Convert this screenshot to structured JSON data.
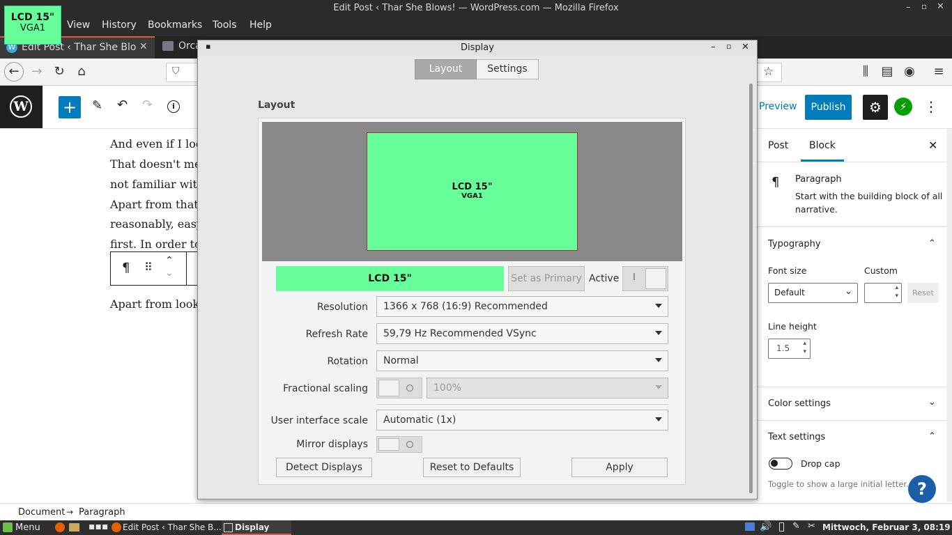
{
  "window": {
    "title": "Edit Post ‹ Thar She Blows! — WordPress.com — Mozilla Firefox"
  },
  "menubar": {
    "items": [
      "View",
      "History",
      "Bookmarks",
      "Tools",
      "Help"
    ]
  },
  "tabs": [
    {
      "label": "Edit Post ‹ Thar She Blow",
      "active": true
    },
    {
      "label": "Orca",
      "active": false
    }
  ],
  "osd": {
    "name": "LCD 15\"",
    "output": "VGA1",
    "color": "#66ff99"
  },
  "wp": {
    "preview_label": "Preview",
    "publish_label": "Publish",
    "content_lines": [
      "And even if I loo",
      "That doesn't mea",
      "not familiar with",
      "Apart from that",
      "reasonably, easy",
      "first. In order to"
    ],
    "paragraph_after": "Apart from looki",
    "sidebar": {
      "tab_post": "Post",
      "tab_block": "Block",
      "block_name": "Paragraph",
      "block_desc_1": "Start with the building block of all",
      "block_desc_2": "narrative.",
      "typography": "Typography",
      "font_size_label": "Font size",
      "custom_label": "Custom",
      "font_size_value": "Default",
      "reset_label": "Reset",
      "line_height_label": "Line height",
      "line_height_value": "1.5",
      "color_settings": "Color settings",
      "text_settings": "Text settings",
      "drop_cap_label": "Drop cap",
      "drop_cap_help": "Toggle to show a large initial letter."
    },
    "breadcrumb": {
      "document": "Document",
      "paragraph": "Paragraph"
    }
  },
  "dialog": {
    "title": "Display",
    "tab_layout": "Layout",
    "tab_settings": "Settings",
    "section_title": "Layout",
    "monitor_name": "LCD 15\"",
    "monitor_output": "VGA1",
    "selected_name": "LCD 15\"",
    "set_primary_label": "Set as Primary",
    "active_label": "Active",
    "active_toggle_mark": "I",
    "resolution_label": "Resolution",
    "resolution_value": "1366 x 768 (16:9)  Recommended",
    "refresh_label": "Refresh Rate",
    "refresh_value": "59,79 Hz  Recommended  VSync",
    "rotation_label": "Rotation",
    "rotation_value": "Normal",
    "fractional_label": "Fractional scaling",
    "fractional_value": "100%",
    "ui_scale_label": "User interface scale",
    "ui_scale_value": "Automatic (1x)",
    "mirror_label": "Mirror displays",
    "detect_label": "Detect Displays",
    "reset_label": "Reset to Defaults",
    "apply_label": "Apply",
    "monitor_color": "#66ff99"
  },
  "taskbar": {
    "menu_label": "Menu",
    "task_firefox": "Edit Post ‹ Thar She B...",
    "task_display": "Display",
    "clock": "Mittwoch, Februar  3, 08:19"
  }
}
